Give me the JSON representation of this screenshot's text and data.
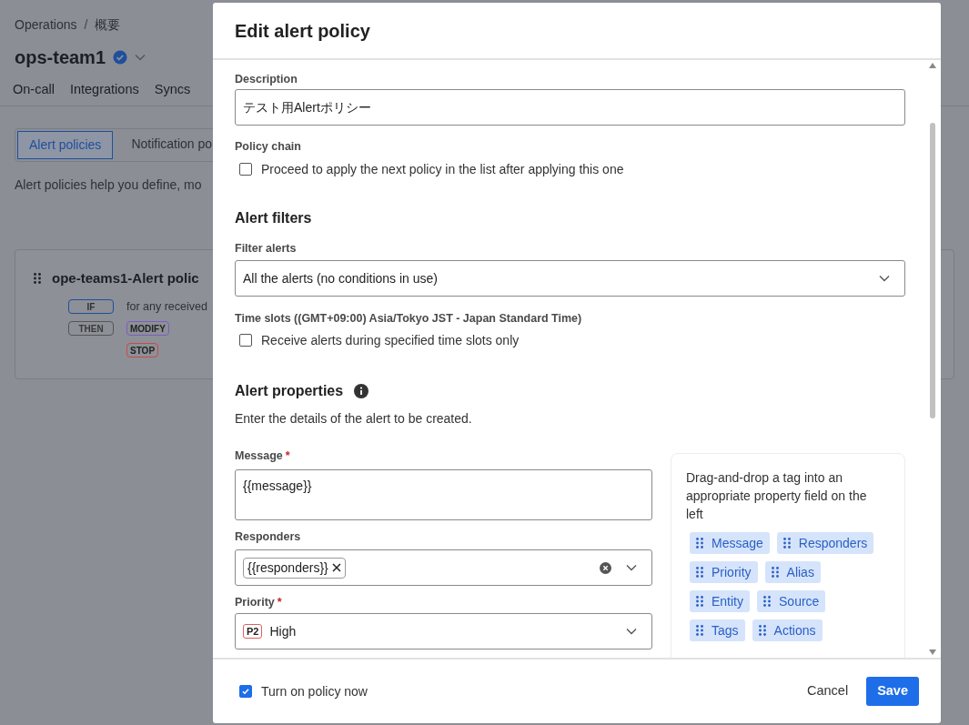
{
  "background_page": {
    "breadcrumb": [
      "Operations",
      "概要"
    ],
    "breadcrumb_separator": "/",
    "team_name": "ops-team1",
    "verified": true,
    "tabs": [
      {
        "label": "On-call",
        "selected": false
      },
      {
        "label": "Integrations",
        "selected": false
      },
      {
        "label": "Syncs",
        "selected": false
      }
    ],
    "subtabs": [
      {
        "label": "Alert policies",
        "selected": true
      },
      {
        "label": "Notification po",
        "selected": false
      }
    ],
    "description": "Alert policies help you define, mo",
    "policy_card": {
      "title": "ope-teams1-Alert polic",
      "rows": [
        {
          "keyword": "IF",
          "text": "for any received",
          "actions": []
        },
        {
          "keyword": "THEN",
          "text": "",
          "actions": [
            {
              "label": "MODIFY",
              "color": "#7c5cc4"
            },
            {
              "label": "STOP",
              "color": "#c94a4a"
            }
          ]
        }
      ]
    }
  },
  "dialog": {
    "title": "Edit alert policy",
    "description": {
      "label": "Description",
      "value": "テスト用Alertポリシー"
    },
    "policy_chain": {
      "label": "Policy chain",
      "checkbox": {
        "label": "Proceed to apply the next policy in the list after applying this one",
        "checked": false
      }
    },
    "alert_filters": {
      "heading": "Alert filters",
      "filter_label": "Filter alerts",
      "filter_value": "All the alerts (no conditions in use)",
      "time_slots_label": "Time slots ((GMT+09:00) Asia/Tokyo JST - Japan Standard Time)",
      "time_slots_checkbox": {
        "label": "Receive alerts during specified time slots only",
        "checked": false
      }
    },
    "alert_properties": {
      "heading": "Alert properties",
      "subtitle": "Enter the details of the alert to be created.",
      "message": {
        "label": "Message",
        "required_mark": "*",
        "value": "{{message}}"
      },
      "responders": {
        "label": "Responders",
        "chips": [
          "{{responders}}"
        ]
      },
      "priority": {
        "label": "Priority",
        "required_mark": "*",
        "badge": "P2",
        "value": "High"
      },
      "tag_panel": {
        "hint": "Drag-and-drop a tag into an appropriate property field on the left",
        "tags": [
          [
            "Message",
            "Responders"
          ],
          [
            "Priority",
            "Alias"
          ],
          [
            "Entity",
            "Source"
          ],
          [
            "Tags",
            "Actions"
          ]
        ]
      }
    },
    "footer": {
      "turn_on": {
        "label": "Turn on policy now",
        "checked": true
      },
      "buttons": [
        "Cancel",
        "Save"
      ]
    }
  }
}
